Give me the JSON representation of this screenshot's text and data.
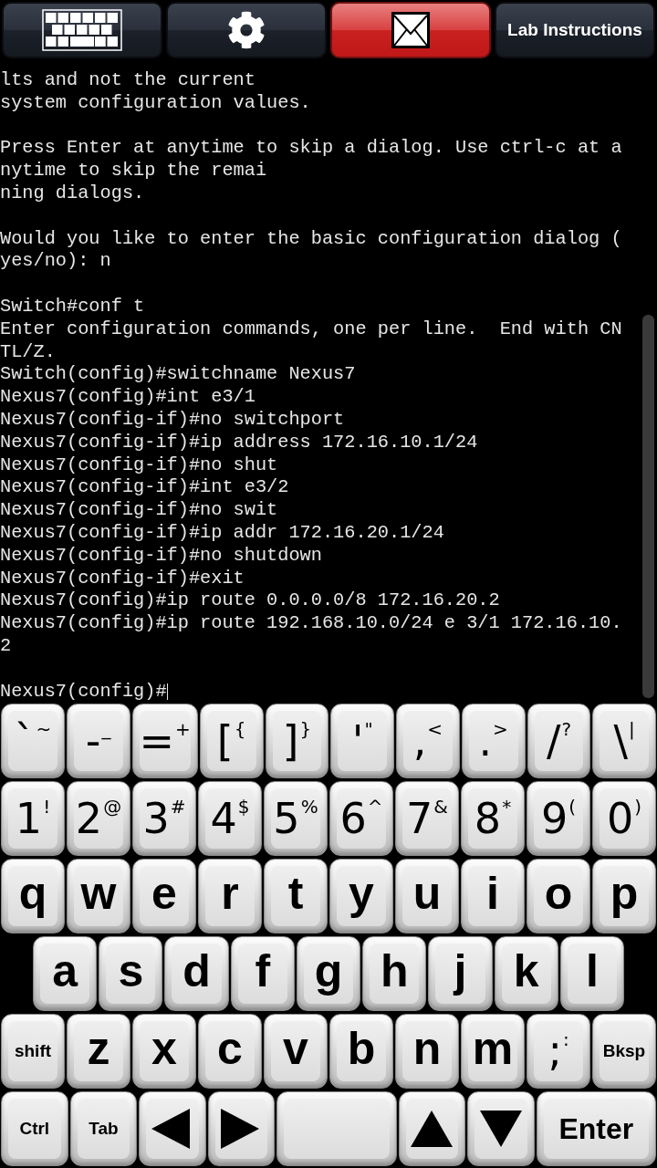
{
  "toolbar": [
    {
      "kind": "keyboard",
      "highlighted": false
    },
    {
      "kind": "settings",
      "highlighted": false
    },
    {
      "kind": "mail",
      "highlighted": true
    },
    {
      "kind": "text",
      "label": "Lab Instructions",
      "highlighted": false
    }
  ],
  "terminal": {
    "blocks": [
      [
        "lts and not the current",
        "system configuration values."
      ],
      [
        "Press Enter at anytime to skip a dialog. Use ctrl-c at a",
        "nytime to skip the remai",
        "ning dialogs."
      ],
      [
        "Would you like to enter the basic configuration dialog (",
        "yes/no): n"
      ],
      [
        "Switch#conf t",
        "Enter configuration commands, one per line.  End with CN",
        "TL/Z.",
        "Switch(config)#switchname Nexus7",
        "Nexus7(config)#int e3/1",
        "Nexus7(config-if)#no switchport",
        "Nexus7(config-if)#ip address 172.16.10.1/24",
        "Nexus7(config-if)#no shut",
        "Nexus7(config-if)#int e3/2",
        "Nexus7(config-if)#no swit",
        "Nexus7(config-if)#ip addr 172.16.20.1/24",
        "Nexus7(config-if)#no shutdown",
        "Nexus7(config-if)#exit",
        "Nexus7(config)#ip route 0.0.0.0/8 172.16.20.2",
        "Nexus7(config)#ip route 192.168.10.0/24 e 3/1 172.16.10.",
        "2"
      ],
      [
        "Nexus7(config)#"
      ]
    ],
    "cursor": true
  },
  "keyboard": {
    "rows": [
      {
        "keys": [
          {
            "kind": "dual",
            "main": "`",
            "alt": "~"
          },
          {
            "kind": "dual",
            "main": "-",
            "alt": "_"
          },
          {
            "kind": "dual",
            "main": "=",
            "alt": "+"
          },
          {
            "kind": "dual",
            "main": "[",
            "alt": "{"
          },
          {
            "kind": "dual",
            "main": "]",
            "alt": "}"
          },
          {
            "kind": "dual",
            "main": "'",
            "alt": "\""
          },
          {
            "kind": "dual",
            "main": ",",
            "alt": "<"
          },
          {
            "kind": "dual",
            "main": ".",
            "alt": ">"
          },
          {
            "kind": "dual",
            "main": "/",
            "alt": "?"
          },
          {
            "kind": "dual",
            "main": "\\",
            "alt": "|"
          }
        ]
      },
      {
        "keys": [
          {
            "kind": "dual",
            "main": "1",
            "alt": "!"
          },
          {
            "kind": "dual",
            "main": "2",
            "alt": "@"
          },
          {
            "kind": "dual",
            "main": "3",
            "alt": "#"
          },
          {
            "kind": "dual",
            "main": "4",
            "alt": "$"
          },
          {
            "kind": "dual",
            "main": "5",
            "alt": "%"
          },
          {
            "kind": "dual",
            "main": "6",
            "alt": "^"
          },
          {
            "kind": "dual",
            "main": "7",
            "alt": "&"
          },
          {
            "kind": "dual",
            "main": "8",
            "alt": "*"
          },
          {
            "kind": "dual",
            "main": "9",
            "alt": "("
          },
          {
            "kind": "dual",
            "main": "0",
            "alt": ")"
          }
        ]
      },
      {
        "keys": [
          {
            "kind": "letter",
            "main": "q"
          },
          {
            "kind": "letter",
            "main": "w"
          },
          {
            "kind": "letter",
            "main": "e"
          },
          {
            "kind": "letter",
            "main": "r"
          },
          {
            "kind": "letter",
            "main": "t"
          },
          {
            "kind": "letter",
            "main": "y"
          },
          {
            "kind": "letter",
            "main": "u"
          },
          {
            "kind": "letter",
            "main": "i"
          },
          {
            "kind": "letter",
            "main": "o"
          },
          {
            "kind": "letter",
            "main": "p"
          }
        ]
      },
      {
        "offset": true,
        "keys": [
          {
            "kind": "letter",
            "main": "a"
          },
          {
            "kind": "letter",
            "main": "s"
          },
          {
            "kind": "letter",
            "main": "d"
          },
          {
            "kind": "letter",
            "main": "f"
          },
          {
            "kind": "letter",
            "main": "g"
          },
          {
            "kind": "letter",
            "main": "h"
          },
          {
            "kind": "letter",
            "main": "j"
          },
          {
            "kind": "letter",
            "main": "k"
          },
          {
            "kind": "letter",
            "main": "l"
          }
        ]
      },
      {
        "keys": [
          {
            "kind": "label",
            "main": "shift"
          },
          {
            "kind": "letter",
            "main": "z"
          },
          {
            "kind": "letter",
            "main": "x"
          },
          {
            "kind": "letter",
            "main": "c"
          },
          {
            "kind": "letter",
            "main": "v"
          },
          {
            "kind": "letter",
            "main": "b"
          },
          {
            "kind": "letter",
            "main": "n"
          },
          {
            "kind": "letter",
            "main": "m"
          },
          {
            "kind": "dual",
            "main": ";",
            "alt": ":"
          },
          {
            "kind": "label",
            "main": "Bksp"
          }
        ]
      },
      {
        "keys": [
          {
            "kind": "label",
            "main": "Ctrl"
          },
          {
            "kind": "label",
            "main": "Tab"
          },
          {
            "kind": "left"
          },
          {
            "kind": "right"
          },
          {
            "kind": "space"
          },
          {
            "kind": "up"
          },
          {
            "kind": "down"
          },
          {
            "kind": "big",
            "main": "Enter"
          }
        ]
      }
    ]
  }
}
